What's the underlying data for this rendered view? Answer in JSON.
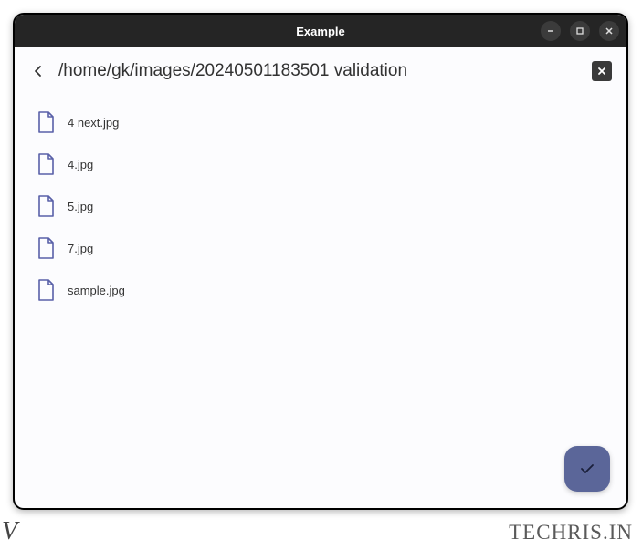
{
  "titlebar": {
    "title": "Example"
  },
  "header": {
    "path": "/home/gk/images/20240501183501 validation"
  },
  "files": [
    {
      "name": "4 next.jpg"
    },
    {
      "name": "4.jpg"
    },
    {
      "name": "5.jpg"
    },
    {
      "name": "7.jpg"
    },
    {
      "name": "sample.jpg"
    }
  ],
  "watermark": {
    "left": "V",
    "right": "TECHRIS.IN"
  },
  "colors": {
    "accent": "#5b6699",
    "file_icon": "#5960a8"
  }
}
